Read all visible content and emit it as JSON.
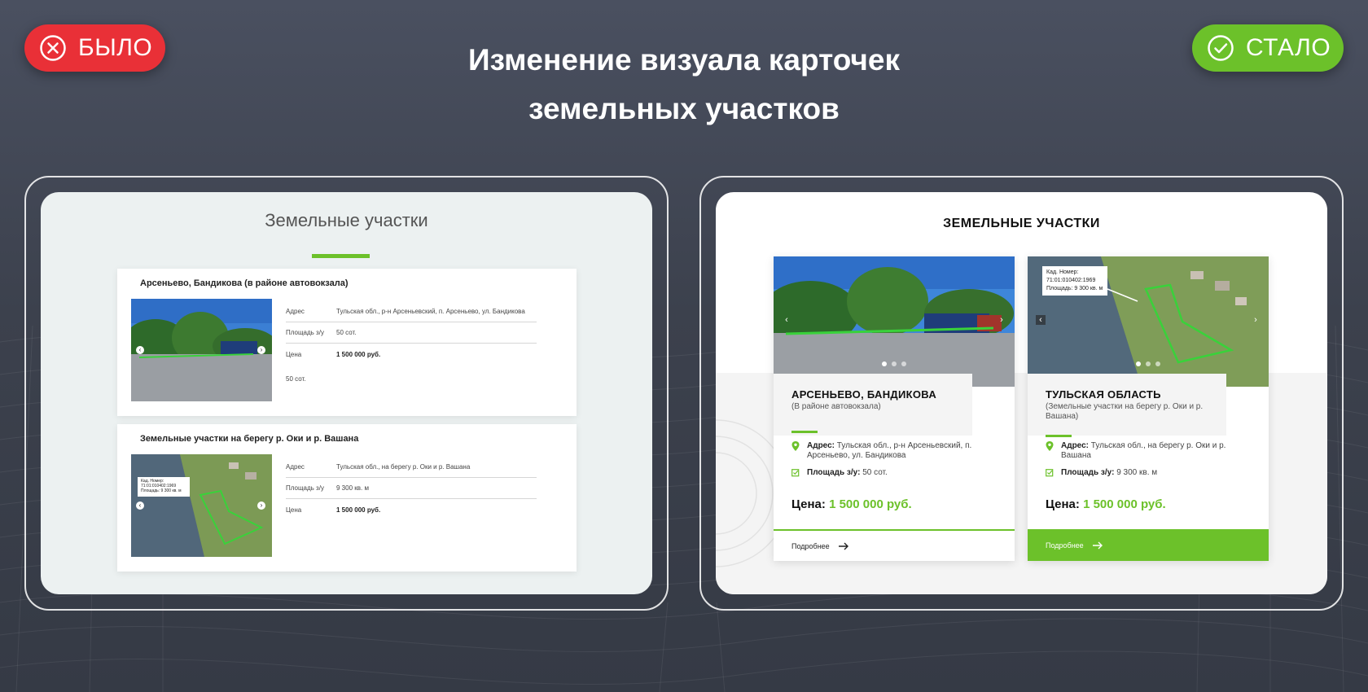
{
  "badges": {
    "before": "БЫЛО",
    "after": "СТАЛО"
  },
  "headline": {
    "line1": "Изменение визуала карточек",
    "line2": "земельных участков"
  },
  "old_design": {
    "title": "Земельные участки",
    "cards": [
      {
        "title": "Арсеньево, Бандикова (в районе автовокзала)",
        "rows": [
          {
            "key": "Адрес",
            "value": "Тульская обл., р-н Арсеньевский, п. Арсеньево, ул. Бандикова"
          },
          {
            "key": "Площадь з/у",
            "value": "50 сот."
          },
          {
            "key": "Цена",
            "value": "1 500 000 руб."
          }
        ],
        "extra": "50 сот."
      },
      {
        "title": "Земельные участки на берегу р. Оки и р. Вашана",
        "rows": [
          {
            "key": "Адрес",
            "value": "Тульская обл., на берегу р. Оки и р. Вашана"
          },
          {
            "key": "Площадь з/у",
            "value": "9 300 кв. м"
          },
          {
            "key": "Цена",
            "value": "1 500 000 руб."
          }
        ],
        "photo_label": [
          "Кад. Номер:",
          "71:01:010402:1969",
          "Площадь: 9 300 кв. м"
        ]
      }
    ]
  },
  "new_design": {
    "title": "ЗЕМЕЛЬНЫЕ УЧАСТКИ",
    "cards": [
      {
        "title": "АРСЕНЬЕВО, БАНДИКОВА",
        "subtitle": "(В районе автовокзала)",
        "address_label": "Адрес:",
        "address": "Тульская обл., р-н Арсеньевский, п. Арсеньево, ул. Бандикова",
        "area_label": "Площадь з/у:",
        "area": "50 сот.",
        "price_label": "Цена:",
        "price": "1 500 000 руб.",
        "more": "Подробнее"
      },
      {
        "title": "ТУЛЬСКАЯ ОБЛАСТЬ",
        "subtitle": "(Земельные участки на берегу р. Оки и р. Вашана)",
        "address_label": "Адрес:",
        "address": "Тульская обл., на берегу р. Оки и р. Вашана",
        "area_label": "Площадь з/у:",
        "area": "9 300 кв. м",
        "price_label": "Цена:",
        "price": "1 500 000 руб.",
        "more": "Подробнее",
        "photo_label": [
          "Кад. Номер:",
          "71:01:010402:1969",
          "Площадь: 9 300 кв. м"
        ]
      }
    ]
  },
  "colors": {
    "accent_green": "#6cc12a",
    "badge_red": "#e93037",
    "background": "#3c414d"
  }
}
